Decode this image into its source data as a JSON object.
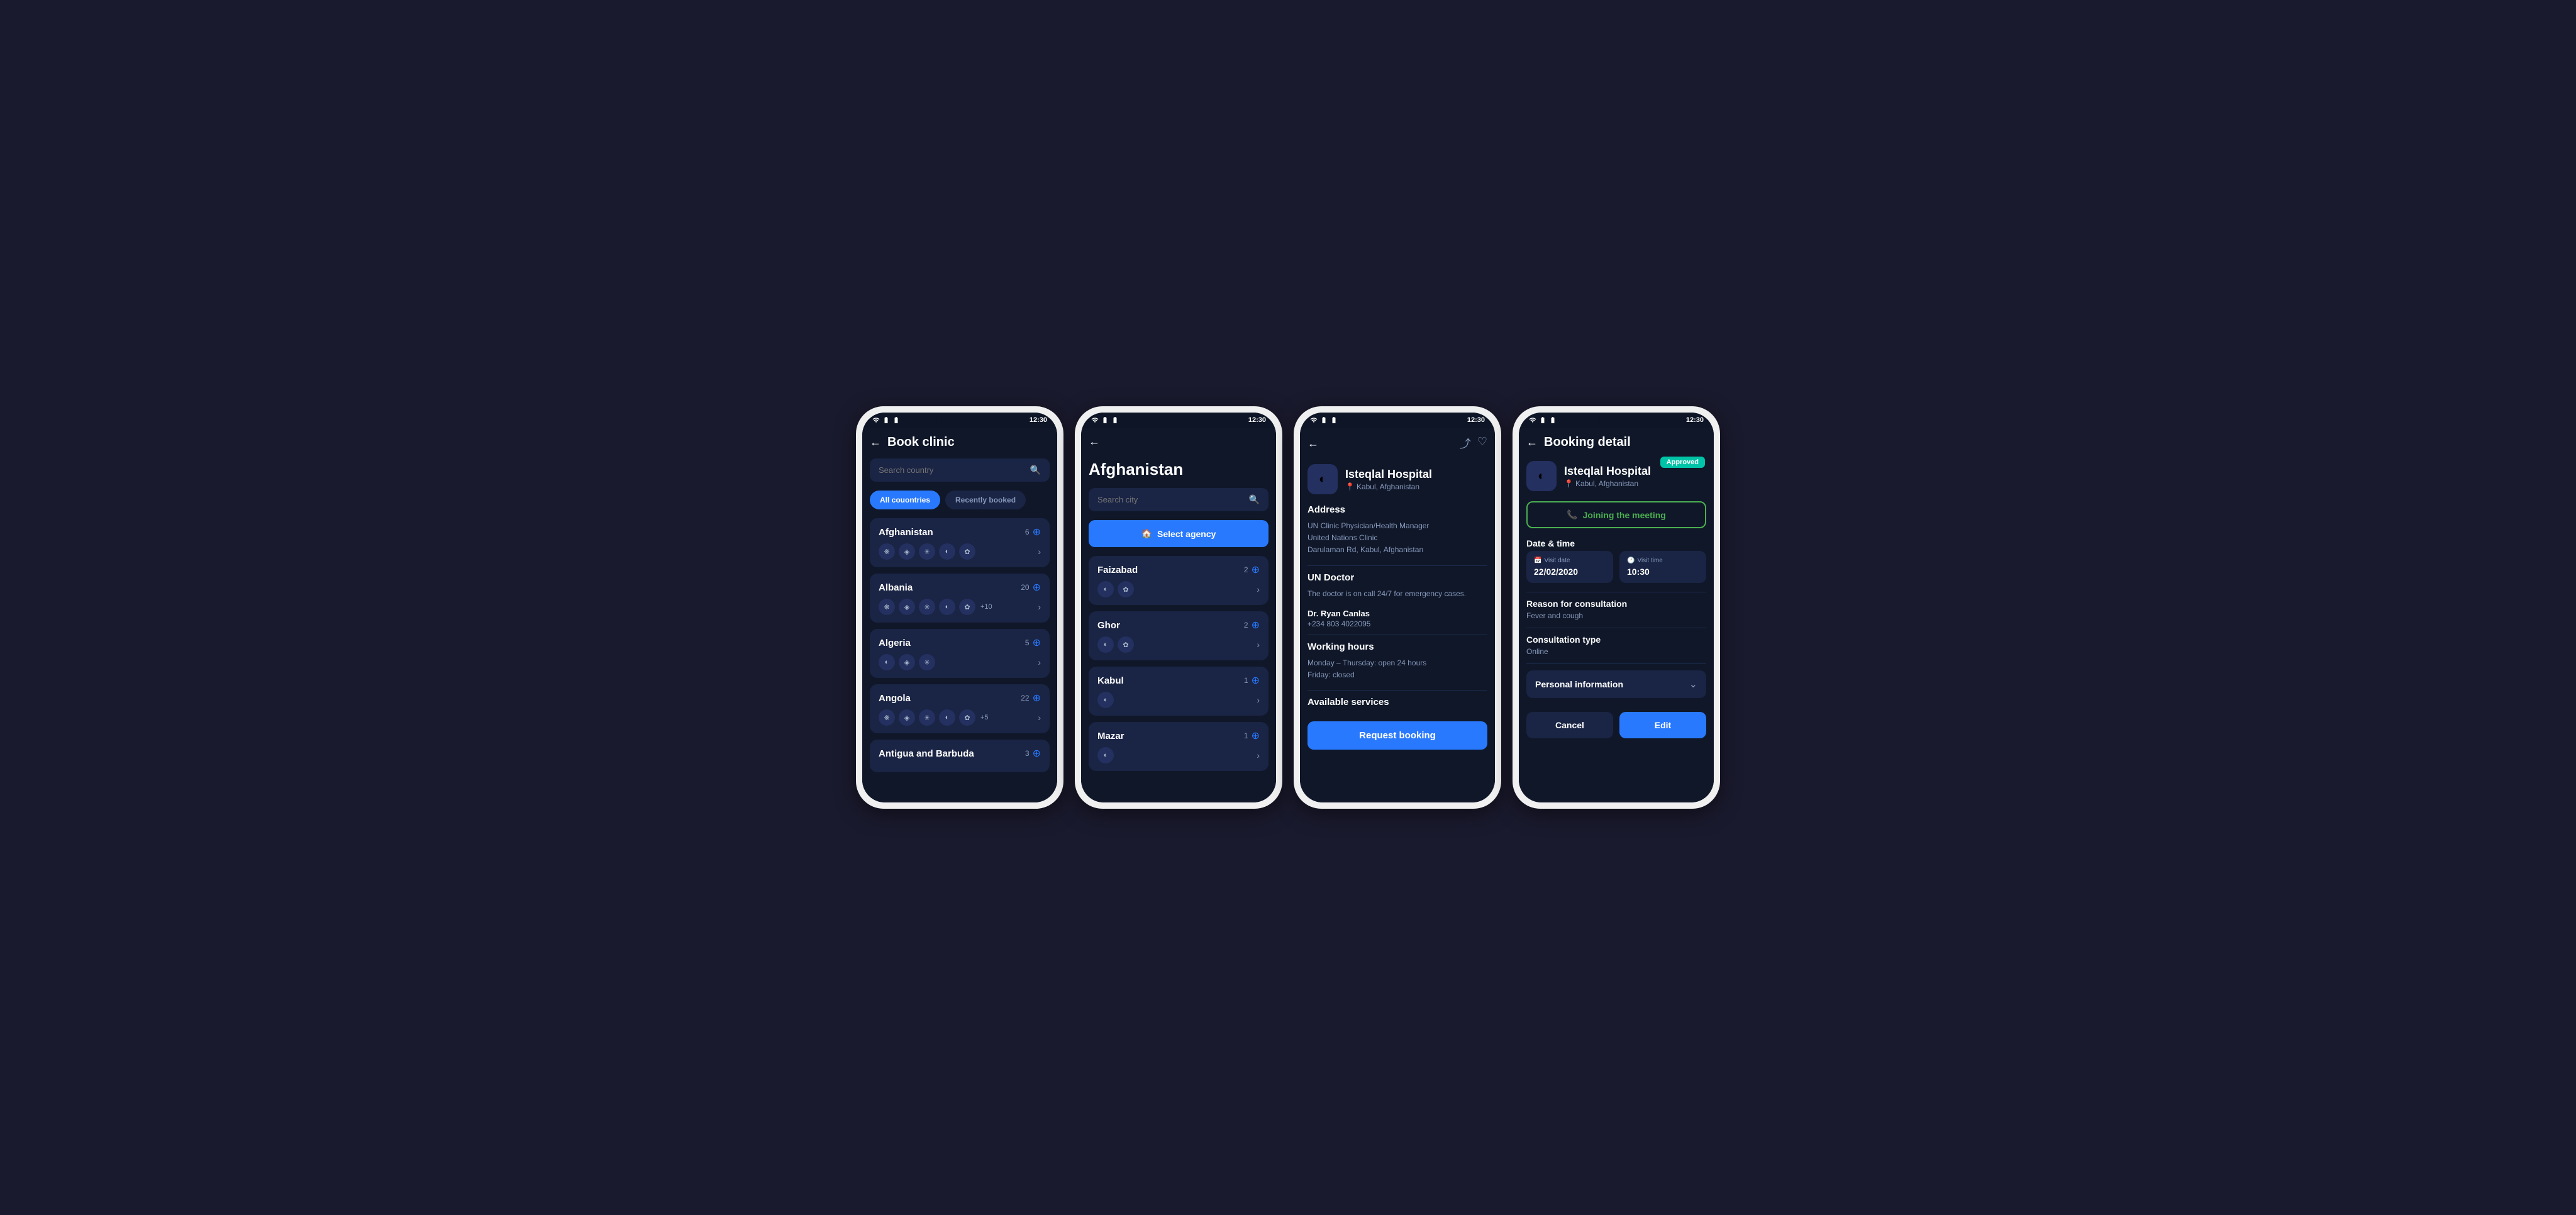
{
  "statusBar": {
    "time": "12:30"
  },
  "screen1": {
    "title": "Book clinic",
    "searchPlaceholder": "Search country",
    "tabs": [
      {
        "label": "All couontries",
        "active": true
      },
      {
        "label": "Recently booked",
        "active": false
      }
    ],
    "countries": [
      {
        "name": "Afghanistan",
        "count": "6",
        "icons": [
          "❋",
          "◈",
          "✳",
          "◐",
          "✿"
        ],
        "more": null
      },
      {
        "name": "Albania",
        "count": "20",
        "icons": [
          "❋",
          "◈",
          "✳",
          "◐",
          "✿"
        ],
        "more": "+10"
      },
      {
        "name": "Algeria",
        "count": "5",
        "icons": [
          "◐",
          "◈",
          "✳"
        ],
        "more": null
      },
      {
        "name": "Angola",
        "count": "22",
        "icons": [
          "❋",
          "◈",
          "✳",
          "◐",
          "✿"
        ],
        "more": "+5"
      },
      {
        "name": "Antigua and Barbuda",
        "count": "3",
        "icons": [],
        "more": null
      }
    ]
  },
  "screen2": {
    "title": "Afghanistan",
    "searchPlaceholder": "Search city",
    "selectAgencyLabel": "Select agency",
    "agencyIcon": "🏠",
    "cities": [
      {
        "name": "Faizabad",
        "count": "2",
        "icons": [
          "◐",
          "✿"
        ]
      },
      {
        "name": "Ghor",
        "count": "2",
        "icons": [
          "◐",
          "✿"
        ]
      },
      {
        "name": "Kabul",
        "count": "1",
        "icons": [
          "◐"
        ]
      },
      {
        "name": "Mazar",
        "count": "1",
        "icons": [
          "◐"
        ]
      }
    ]
  },
  "screen3": {
    "hospitalName": "Isteqlal Hospital",
    "hospitalLocation": "Kabul, Afghanistan",
    "hospitalIcon": "◐",
    "addressLabel": "Address",
    "addressLines": [
      "UN Clinic Physician/Health Manager",
      "United Nations Clinic",
      "Darulaman Rd, Kabul, Afghanistan"
    ],
    "doctorLabel": "UN Doctor",
    "doctorDesc": "The doctor is on call 24/7 for emergency cases.",
    "doctorName": "Dr. Ryan Canlas",
    "doctorPhone": "+234 803 4022095",
    "workingHoursLabel": "Working hours",
    "workingHoursLines": [
      "Monday – Thursday: open 24 hours",
      "Friday: closed"
    ],
    "servicesLabel": "Available services",
    "requestBookingLabel": "Request booking"
  },
  "screen4": {
    "title": "Booking detail",
    "approvedBadge": "Approved",
    "hospitalName": "Isteqlal Hospital",
    "hospitalLocation": "Kabul, Afghanistan",
    "hospitalIcon": "◐",
    "joiningLabel": "Joining the meeting",
    "phoneIcon": "📞",
    "dateTimeLabel": "Date & time",
    "visitDateLabel": "Visit date",
    "visitDateValue": "22/02/2020",
    "visitTimeLabel": "Visit time",
    "visitTimeValue": "10:30",
    "reasonLabel": "Reason for consultation",
    "reasonValue": "Fever and cough",
    "consultTypeLabel": "Consultation type",
    "consultTypeValue": "Online",
    "personalInfoLabel": "Personal information",
    "cancelLabel": "Cancel",
    "editLabel": "Edit"
  }
}
